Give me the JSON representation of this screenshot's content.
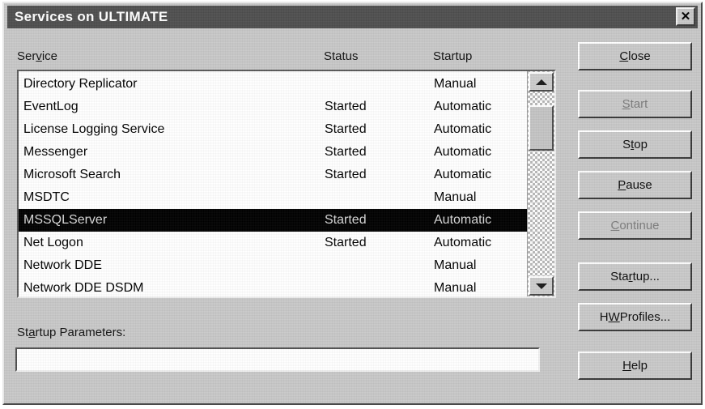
{
  "window": {
    "title": "Services on ULTIMATE",
    "close_icon": "close-icon",
    "close_glyph": "✕"
  },
  "list": {
    "columns": {
      "service": {
        "pre": "Ser",
        "accel": "v",
        "post": "ice"
      },
      "status": "Status",
      "startup": "Startup"
    },
    "rows": [
      {
        "name": "Directory Replicator",
        "status": "",
        "startup": "Manual",
        "selected": false
      },
      {
        "name": "EventLog",
        "status": "Started",
        "startup": "Automatic",
        "selected": false
      },
      {
        "name": "License Logging Service",
        "status": "Started",
        "startup": "Automatic",
        "selected": false
      },
      {
        "name": "Messenger",
        "status": "Started",
        "startup": "Automatic",
        "selected": false
      },
      {
        "name": "Microsoft Search",
        "status": "Started",
        "startup": "Automatic",
        "selected": false
      },
      {
        "name": "MSDTC",
        "status": "",
        "startup": "Manual",
        "selected": false
      },
      {
        "name": "MSSQLServer",
        "status": "Started",
        "startup": "Automatic",
        "selected": true
      },
      {
        "name": "Net Logon",
        "status": "Started",
        "startup": "Automatic",
        "selected": false
      },
      {
        "name": "Network DDE",
        "status": "",
        "startup": "Manual",
        "selected": false
      },
      {
        "name": "Network DDE DSDM",
        "status": "",
        "startup": "Manual",
        "selected": false
      }
    ],
    "scrollbar": {
      "up_icon": "scroll-up-arrow-icon",
      "down_icon": "scroll-down-arrow-icon"
    }
  },
  "params": {
    "label": {
      "pre": "St",
      "accel": "a",
      "post": "rtup Parameters:"
    },
    "value": "",
    "placeholder": ""
  },
  "buttons": [
    {
      "id": "close",
      "pre": "",
      "accel": "C",
      "post": "lose",
      "label": "Close",
      "disabled": false
    },
    {
      "id": "start",
      "pre": "",
      "accel": "S",
      "post": "tart",
      "label": "Start",
      "disabled": true
    },
    {
      "id": "stop",
      "pre": "S",
      "accel": "t",
      "post": "op",
      "label": "Stop",
      "disabled": false
    },
    {
      "id": "pause",
      "pre": "",
      "accel": "P",
      "post": "ause",
      "label": "Pause",
      "disabled": false
    },
    {
      "id": "continue",
      "pre": "",
      "accel": "C",
      "post": "ontinue",
      "label": "Continue",
      "disabled": true
    },
    {
      "id": "startup",
      "pre": "Sta",
      "accel": "r",
      "post": "tup...",
      "label": "Startup...",
      "disabled": false
    },
    {
      "id": "hwprof",
      "pre": "H",
      "accel": "W",
      "post": " Profiles...",
      "label": "HW Profiles...",
      "disabled": false
    },
    {
      "id": "help",
      "pre": "",
      "accel": "H",
      "post": "elp",
      "label": "Help",
      "disabled": false
    }
  ],
  "colors": {
    "dialog_face": "#c8c8c8",
    "titlebar": "#4f4f4f",
    "titlebar_text": "#ffffff",
    "selection_bg": "#000000",
    "selection_fg": "#d8d8d8",
    "list_bg": "#ffffff",
    "disabled_text": "#7c7c7c"
  }
}
